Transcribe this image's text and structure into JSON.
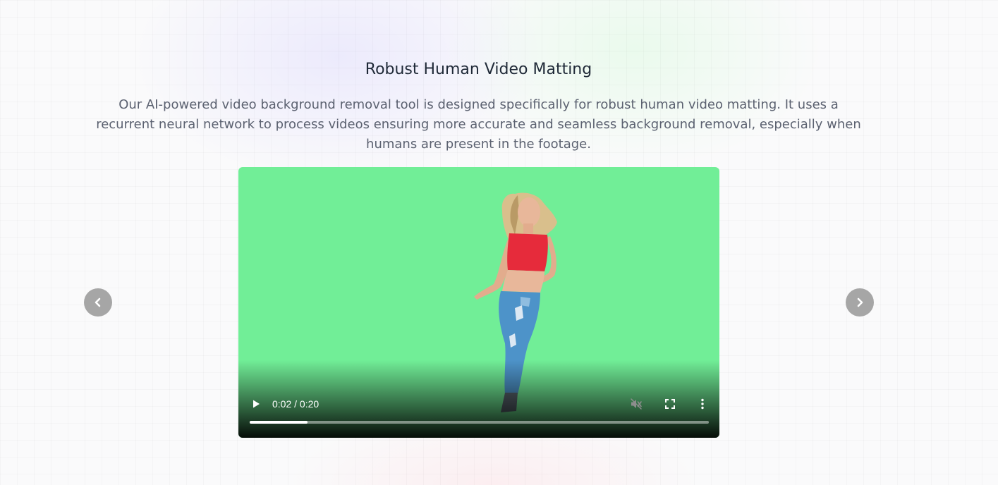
{
  "section": {
    "title": "Robust Human Video Matting",
    "description": "Our AI-powered video background removal tool is designed specifically for robust human video matting. It uses a recurrent neural network to process videos ensuring more accurate and seamless background removal, especially when humans are present in the footage."
  },
  "video": {
    "time_display": "0:02 / 0:20",
    "progress": 0.126,
    "background_color": "#71ee97",
    "controls": {
      "play_icon": "play-icon",
      "mute_icon": "muted-speaker-icon",
      "fullscreen_icon": "fullscreen-icon",
      "menu_icon": "vertical-dots-icon"
    }
  },
  "carousel": {
    "prev_icon": "chevron-left-icon",
    "next_icon": "chevron-right-icon"
  }
}
